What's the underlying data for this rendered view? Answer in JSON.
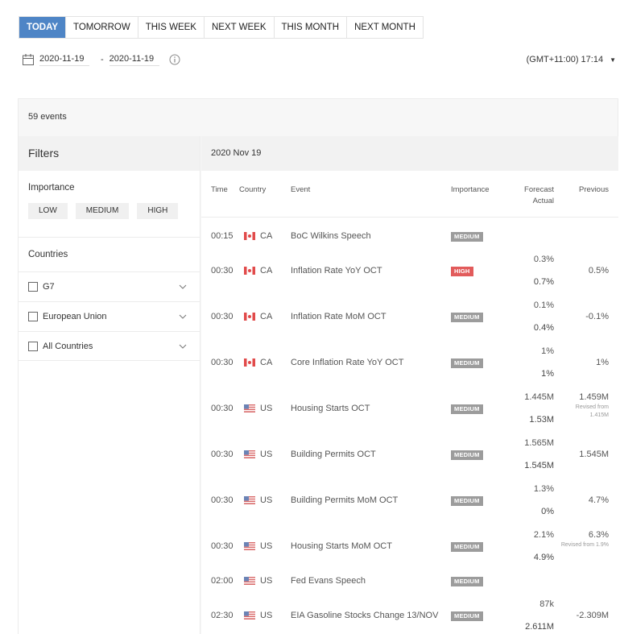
{
  "tabs": [
    {
      "label": "TODAY",
      "active": true
    },
    {
      "label": "TOMORROW",
      "active": false
    },
    {
      "label": "THIS WEEK",
      "active": false
    },
    {
      "label": "NEXT WEEK",
      "active": false
    },
    {
      "label": "THIS MONTH",
      "active": false
    },
    {
      "label": "NEXT MONTH",
      "active": false
    }
  ],
  "date_range": {
    "from": "2020-11-19",
    "separator": "-",
    "to": "2020-11-19"
  },
  "timezone": "(GMT+11:00) 17:14",
  "events_count": "59 events",
  "filters": {
    "title": "Filters",
    "importance_label": "Importance",
    "importance_buttons": [
      "LOW",
      "MEDIUM",
      "HIGH"
    ],
    "countries_label": "Countries",
    "country_groups": [
      "G7",
      "European Union",
      "All Countries"
    ]
  },
  "table": {
    "date": "2020 Nov 19",
    "headers": {
      "time": "Time",
      "country": "Country",
      "event": "Event",
      "importance": "Importance",
      "forecast": "Forecast",
      "actual": "Actual",
      "previous": "Previous"
    },
    "rows": [
      {
        "time": "00:15",
        "flag": "ca",
        "country": "CA",
        "event": "BoC Wilkins Speech",
        "importance": "MEDIUM",
        "forecast": "",
        "actual": "",
        "previous": "",
        "revised": ""
      },
      {
        "time": "00:30",
        "flag": "ca",
        "country": "CA",
        "event": "Inflation Rate YoY OCT",
        "importance": "HIGH",
        "forecast": "0.3%",
        "actual": "0.7%",
        "previous": "0.5%",
        "revised": ""
      },
      {
        "time": "00:30",
        "flag": "ca",
        "country": "CA",
        "event": "Inflation Rate MoM OCT",
        "importance": "MEDIUM",
        "forecast": "0.1%",
        "actual": "0.4%",
        "previous": "-0.1%",
        "revised": ""
      },
      {
        "time": "00:30",
        "flag": "ca",
        "country": "CA",
        "event": "Core Inflation Rate YoY OCT",
        "importance": "MEDIUM",
        "forecast": "1%",
        "actual": "1%",
        "previous": "1%",
        "revised": ""
      },
      {
        "time": "00:30",
        "flag": "us",
        "country": "US",
        "event": "Housing Starts OCT",
        "importance": "MEDIUM",
        "forecast": "1.445M",
        "actual": "1.53M",
        "previous": "1.459M",
        "revised": "Revised from 1.415M"
      },
      {
        "time": "00:30",
        "flag": "us",
        "country": "US",
        "event": "Building Permits OCT",
        "importance": "MEDIUM",
        "forecast": "1.565M",
        "actual": "1.545M",
        "previous": "1.545M",
        "revised": ""
      },
      {
        "time": "00:30",
        "flag": "us",
        "country": "US",
        "event": "Building Permits MoM OCT",
        "importance": "MEDIUM",
        "forecast": "1.3%",
        "actual": "0%",
        "previous": "4.7%",
        "revised": ""
      },
      {
        "time": "00:30",
        "flag": "us",
        "country": "US",
        "event": "Housing Starts MoM OCT",
        "importance": "MEDIUM",
        "forecast": "2.1%",
        "actual": "4.9%",
        "previous": "6.3%",
        "revised": "Revised from 1.9%"
      },
      {
        "time": "02:00",
        "flag": "us",
        "country": "US",
        "event": "Fed Evans Speech",
        "importance": "MEDIUM",
        "forecast": "",
        "actual": "",
        "previous": "",
        "revised": ""
      },
      {
        "time": "02:30",
        "flag": "us",
        "country": "US",
        "event": "EIA Gasoline Stocks Change 13/NOV",
        "importance": "MEDIUM",
        "forecast": "87k",
        "actual": "2.611M",
        "previous": "-2.309M",
        "revised": ""
      }
    ]
  }
}
